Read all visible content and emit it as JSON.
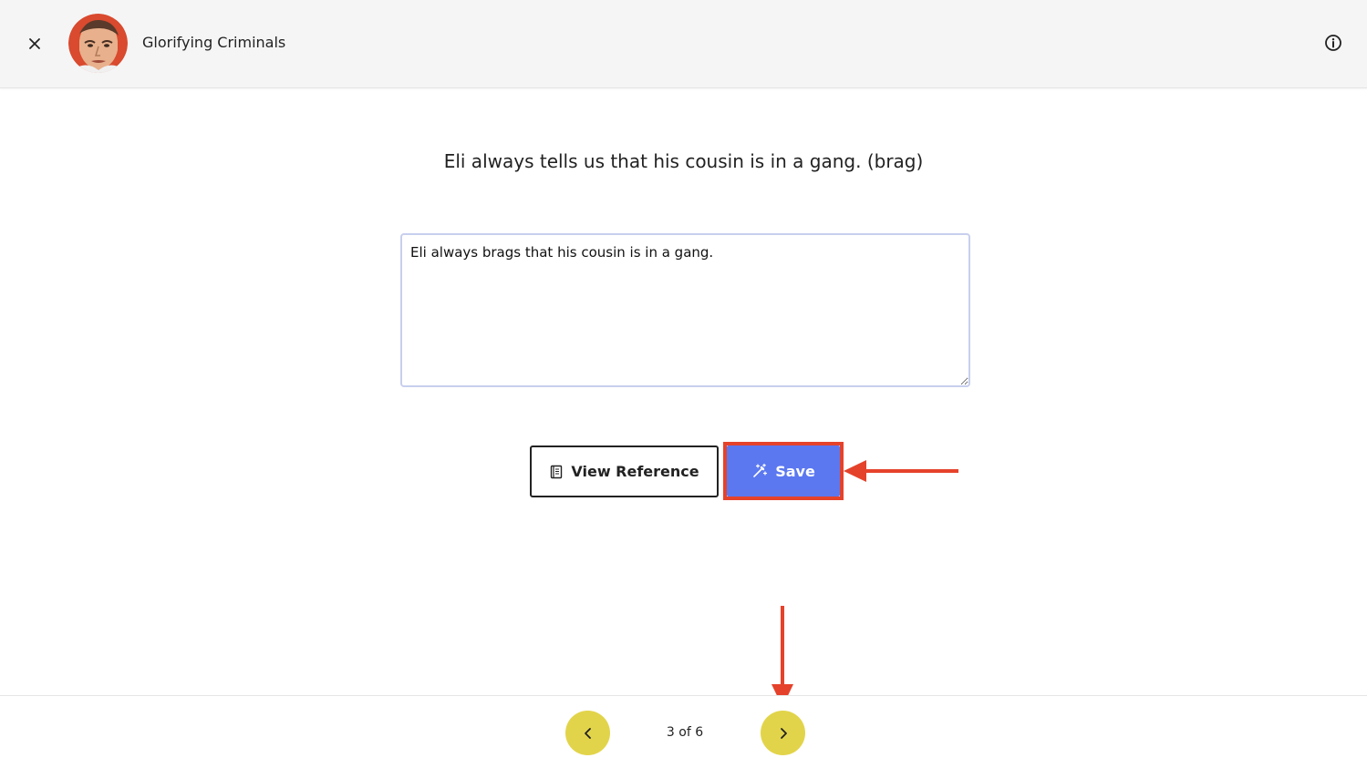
{
  "header": {
    "title": "Glorifying Criminals",
    "close_icon": "close-icon",
    "info_icon": "info-icon"
  },
  "main": {
    "prompt": "Eli always tells us that his cousin is in a gang. (brag)",
    "answer_value": "Eli always brags that his cousin is in a gang.",
    "view_reference_label": "View Reference",
    "save_label": "Save"
  },
  "footer": {
    "page_indicator": "3 of 6"
  },
  "colors": {
    "save_button": "#5b78f0",
    "nav_button": "#e2d44a",
    "annotation": "#e5422b"
  }
}
